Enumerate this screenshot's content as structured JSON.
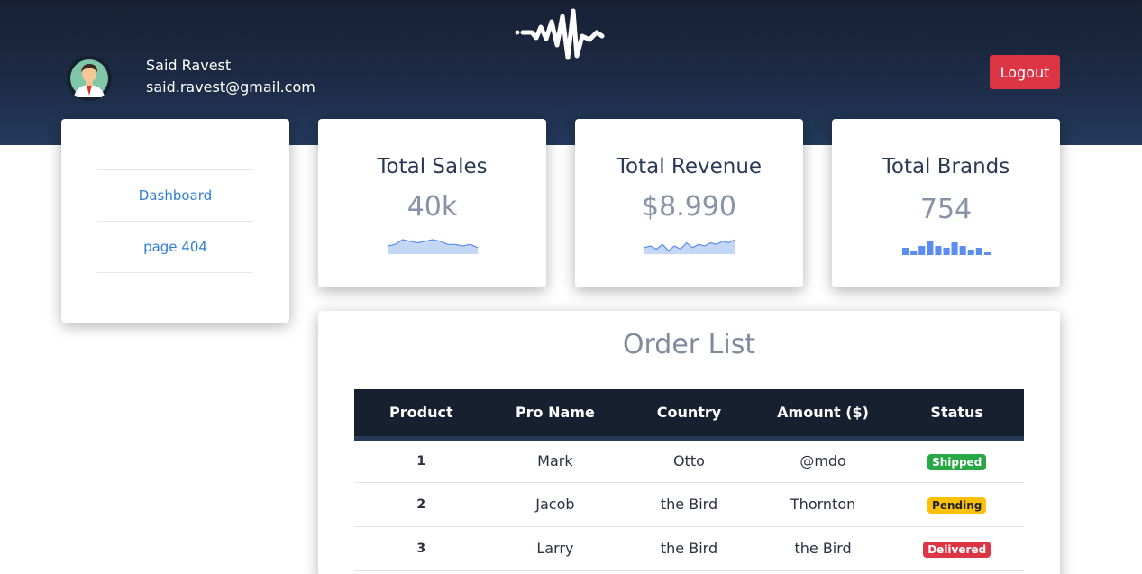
{
  "brand": {
    "logo_icon": "soundwave-logo-icon"
  },
  "user": {
    "name": "Said Ravest",
    "email": "said.ravest@gmail.com",
    "avatar_icon": "user-avatar-icon"
  },
  "header": {
    "logout_label": "Logout"
  },
  "sidebar": {
    "items": [
      {
        "label": "Dashboard"
      },
      {
        "label": "page 404"
      }
    ]
  },
  "stats": [
    {
      "title": "Total Sales",
      "value": "40k",
      "sparkline": "area",
      "spark_values": [
        4,
        5,
        8,
        7,
        6,
        7,
        8,
        7,
        5,
        5,
        4,
        5,
        3
      ],
      "color": "#5b8def"
    },
    {
      "title": "Total Revenue",
      "value": "$8.990",
      "sparkline": "area",
      "spark_values": [
        3,
        4,
        2,
        5,
        1,
        4,
        2,
        6,
        3,
        5,
        4,
        6,
        5,
        7,
        6,
        8
      ],
      "color": "#5b8def"
    },
    {
      "title": "Total Brands",
      "value": "754",
      "sparkline": "bar",
      "spark_values": [
        4,
        2,
        5,
        8,
        5,
        4,
        7,
        5,
        3,
        4,
        1
      ],
      "color": "#5b8def"
    }
  ],
  "orders": {
    "title": "Order List",
    "columns": [
      "Product",
      "Pro Name",
      "Country",
      "Amount ($)",
      "Status"
    ],
    "rows": [
      {
        "product": "1",
        "name": "Mark",
        "country": "Otto",
        "amount": "@mdo",
        "status": "Shipped",
        "status_color": "#28a745",
        "status_text_color": "#ffffff"
      },
      {
        "product": "2",
        "name": "Jacob",
        "country": "the Bird",
        "amount": "Thornton",
        "status": "Pending",
        "status_color": "#ffc107",
        "status_text_color": "#212529"
      },
      {
        "product": "3",
        "name": "Larry",
        "country": "the Bird",
        "amount": "the Bird",
        "status": "Delivered",
        "status_color": "#dc3545",
        "status_text_color": "#ffffff"
      }
    ]
  },
  "colors": {
    "header": "#1d2b45",
    "accent_link": "#2f7ed8",
    "danger": "#dc3545",
    "table_head": "#17202f"
  }
}
